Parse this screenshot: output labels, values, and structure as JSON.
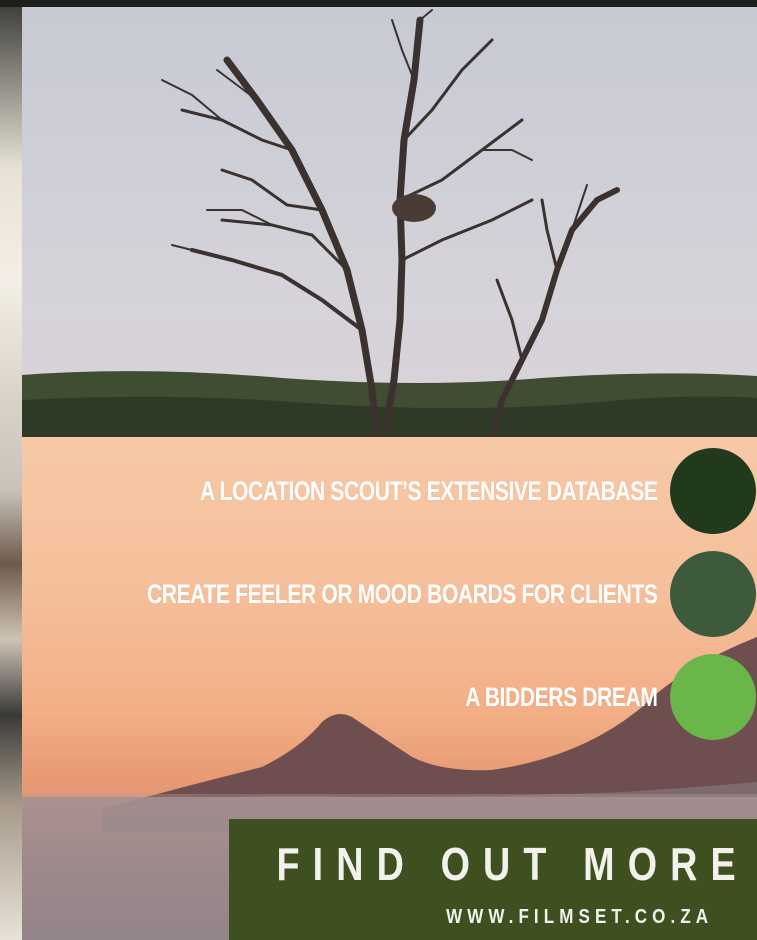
{
  "bullets": [
    {
      "text": "A LOCATION SCOUT’S EXTENSIVE DATABASE",
      "color": "#213a1c"
    },
    {
      "text": "CREATE FEELER OR MOOD BOARDS FOR CLIENTS",
      "color": "#3e5a3d"
    },
    {
      "text": "A BIDDERS DREAM",
      "color": "#6ab648"
    }
  ],
  "cta": {
    "title": "FIND OUT MORE",
    "url": "WWW.FILMSET.CO.ZA",
    "background": "#3f5020"
  }
}
